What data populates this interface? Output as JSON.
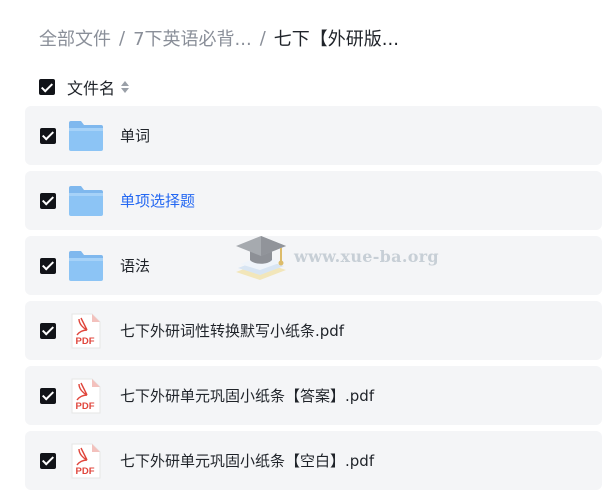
{
  "breadcrumb": {
    "root": "全部文件",
    "level1": "7下英语必背...",
    "current": "七下【外研版...",
    "separator": "/"
  },
  "list_header": {
    "name_label": "文件名",
    "all_checked": true
  },
  "files": [
    {
      "name": "单词",
      "type": "folder",
      "checked": true,
      "icon": "folder-icon"
    },
    {
      "name": "单项选择题",
      "type": "folder",
      "checked": true,
      "icon": "folder-icon",
      "highlighted": true
    },
    {
      "name": "语法",
      "type": "folder",
      "checked": true,
      "icon": "folder-icon"
    },
    {
      "name": "七下外研词性转换默写小纸条.pdf",
      "type": "pdf",
      "checked": true,
      "icon": "pdf-icon"
    },
    {
      "name": "七下外研单元巩固小纸条【答案】.pdf",
      "type": "pdf",
      "checked": true,
      "icon": "pdf-icon"
    },
    {
      "name": "七下外研单元巩固小纸条【空白】.pdf",
      "type": "pdf",
      "checked": true,
      "icon": "pdf-icon"
    }
  ],
  "icons": {
    "pdf_label": "PDF"
  },
  "watermark": {
    "text": "www.xue-ba.org"
  },
  "colors": {
    "highlight": "#2468f2",
    "folder": "#8cc4f5",
    "pdf": "#e0463c",
    "row_bg": "#f4f5f7"
  }
}
